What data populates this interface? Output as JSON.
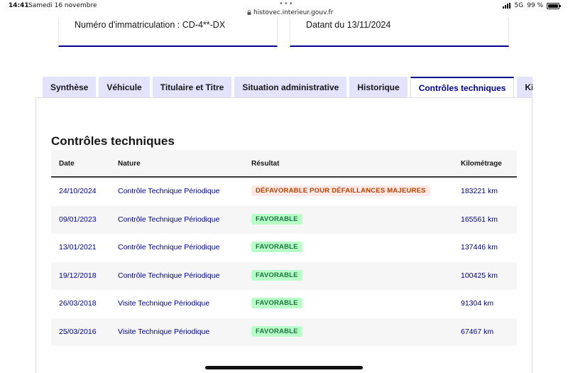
{
  "status_bar": {
    "time": "14:41",
    "date": "Samedi 16 novembre",
    "url": "histovec.interieur.gouv.fr",
    "network": "5G",
    "battery": "99 %",
    "battery_level": 0.99
  },
  "cards": {
    "left_text": "Numéro d'immatriculation : CD-4**-DX",
    "right_text": "Datant du 13/11/2024"
  },
  "tabs": [
    {
      "label": "Synthèse",
      "active": false
    },
    {
      "label": "Véhicule",
      "active": false
    },
    {
      "label": "Titulaire et Titre",
      "active": false
    },
    {
      "label": "Situation administrative",
      "active": false
    },
    {
      "label": "Historique",
      "active": false
    },
    {
      "label": "Contrôles techniques",
      "active": true
    },
    {
      "label": "Kil",
      "active": false
    }
  ],
  "section": {
    "title": "Contrôles techniques"
  },
  "table": {
    "headers": {
      "date": "Date",
      "nature": "Nature",
      "result": "Résultat",
      "mileage": "Kilométrage"
    },
    "rows": [
      {
        "date": "24/10/2024",
        "nature": "Contrôle Technique Périodique",
        "result": "DÉFAVORABLE POUR DÉFAILLANCES MAJEURES",
        "status": "ko",
        "mileage": "183221 km"
      },
      {
        "date": "09/01/2023",
        "nature": "Contrôle Technique Périodique",
        "result": "FAVORABLE",
        "status": "ok",
        "mileage": "165561 km"
      },
      {
        "date": "13/01/2021",
        "nature": "Contrôle Technique Périodique",
        "result": "FAVORABLE",
        "status": "ok",
        "mileage": "137446 km"
      },
      {
        "date": "19/12/2018",
        "nature": "Contrôle Technique Périodique",
        "result": "FAVORABLE",
        "status": "ok",
        "mileage": "100425 km"
      },
      {
        "date": "26/03/2018",
        "nature": "Visite Technique Périodique",
        "result": "FAVORABLE",
        "status": "ok",
        "mileage": "91304 km"
      },
      {
        "date": "25/03/2016",
        "nature": "Visite Technique Périodique",
        "result": "FAVORABLE",
        "status": "ok",
        "mileage": "67467 km"
      }
    ]
  },
  "colors": {
    "accent": "#000091",
    "tab_bg": "#e3e3fd",
    "success_bg": "#b8fec9",
    "success_text": "#18753c",
    "error_bg": "#ffe9e6",
    "error_text": "#b34000"
  }
}
